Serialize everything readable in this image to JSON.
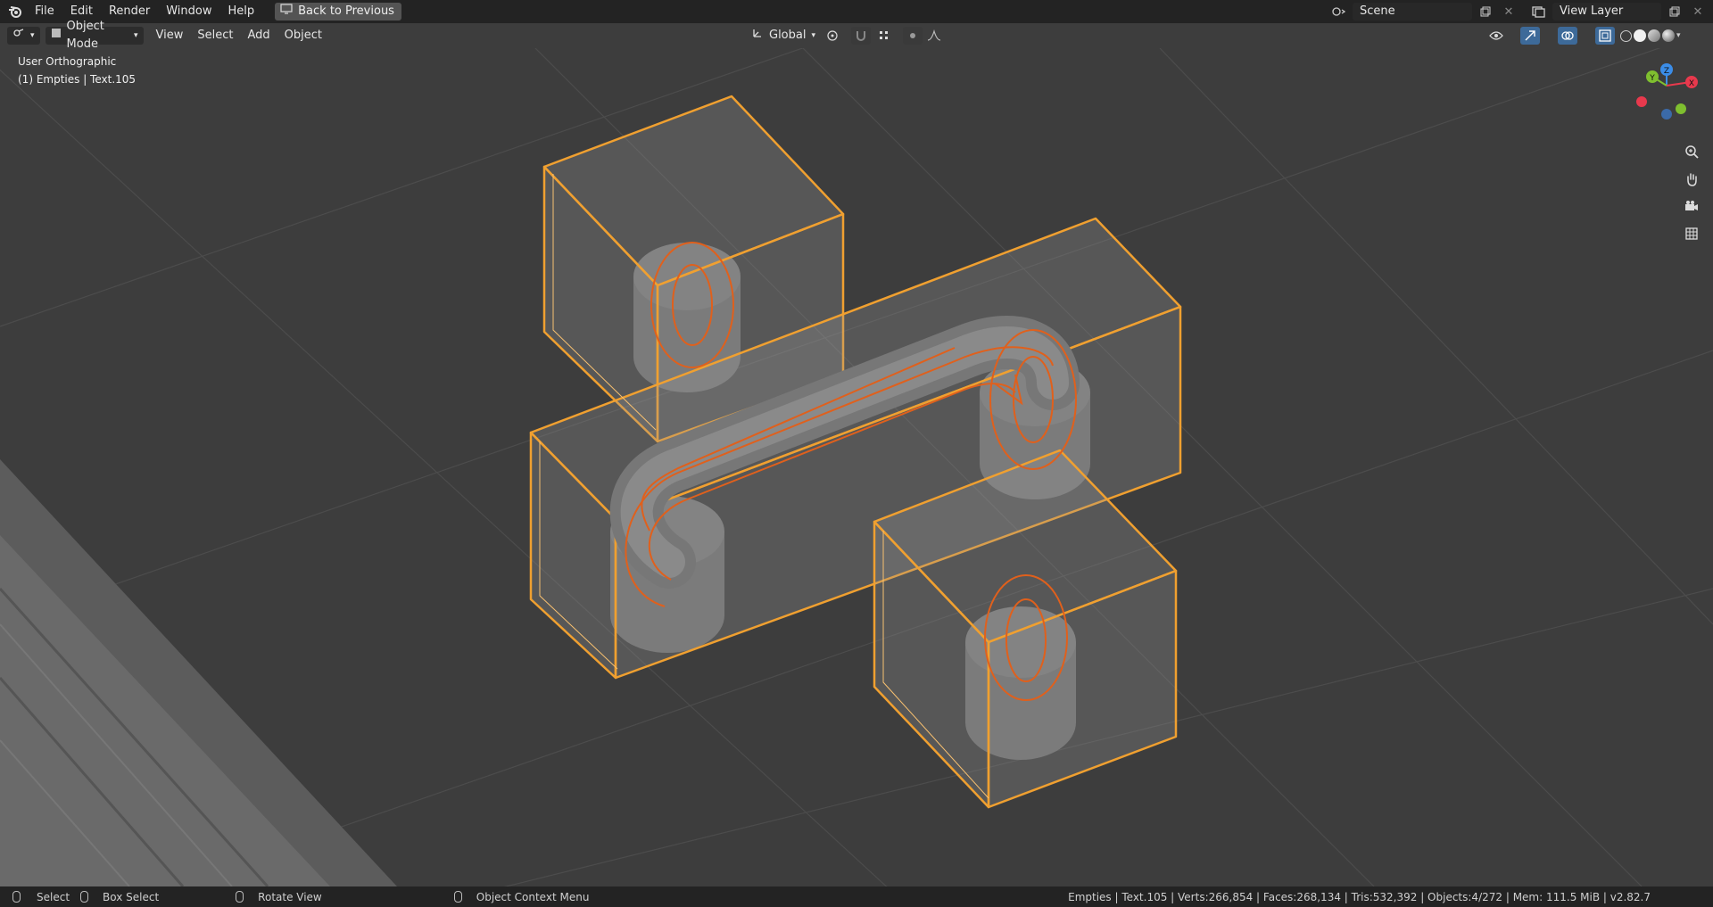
{
  "menu": {
    "items": [
      "File",
      "Edit",
      "Render",
      "Window",
      "Help"
    ],
    "back_label": "Back to Previous"
  },
  "topright": {
    "scene_value": "Scene",
    "view_layer_value": "View Layer"
  },
  "viewport_header": {
    "mode_label": "Object Mode",
    "menus": [
      "View",
      "Select",
      "Add",
      "Object"
    ],
    "orientation_label": "Global"
  },
  "overlay": {
    "view_name": "User Orthographic",
    "active_object": "(1) Empties | Text.105"
  },
  "gizmo": {
    "x": "X",
    "y": "Y",
    "z": "Z"
  },
  "statusbar": {
    "select": "Select",
    "box_select": "Box Select",
    "rotate_view": "Rotate View",
    "context_menu": "Object Context Menu",
    "stats": "Empties | Text.105 | Verts:266,854 | Faces:268,134 | Tris:532,392 | Objects:4/272 | Mem: 111.5 MiB | v2.82.7"
  },
  "colors": {
    "selection_outline": "#f0a030",
    "curve": "#e0601c",
    "axis_x": "#e8394d",
    "axis_y": "#7fbf2f",
    "axis_z": "#3b8de8"
  }
}
